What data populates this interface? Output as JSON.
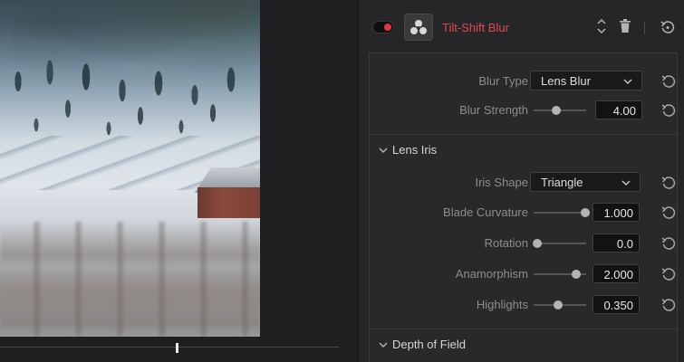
{
  "effect": {
    "title": "Tilt-Shift Blur",
    "enabled": true,
    "accent_color": "#e0484c",
    "icons": [
      "toggle-switch",
      "effect-icon",
      "sort-icon",
      "trash-icon",
      "reset-icon"
    ]
  },
  "params": {
    "blur_type": {
      "label": "Blur Type",
      "value": "Lens Blur"
    },
    "blur_strength": {
      "label": "Blur Strength",
      "value": "4.00",
      "level": 0.4
    }
  },
  "lens_iris": {
    "title": "Lens Iris",
    "iris_shape": {
      "label": "Iris Shape",
      "value": "Triangle"
    },
    "blade_curvature": {
      "label": "Blade Curvature",
      "value": "1.000",
      "level": 1.0
    },
    "rotation": {
      "label": "Rotation",
      "value": "0.0",
      "level": 0.0
    },
    "anamorphism": {
      "label": "Anamorphism",
      "value": "2.000",
      "level": 0.8
    },
    "highlights": {
      "label": "Highlights",
      "value": "0.350",
      "level": 0.45
    }
  },
  "depth_of_field": {
    "title": "Depth of Field"
  },
  "viewer": {
    "playhead_position": 0.52
  }
}
